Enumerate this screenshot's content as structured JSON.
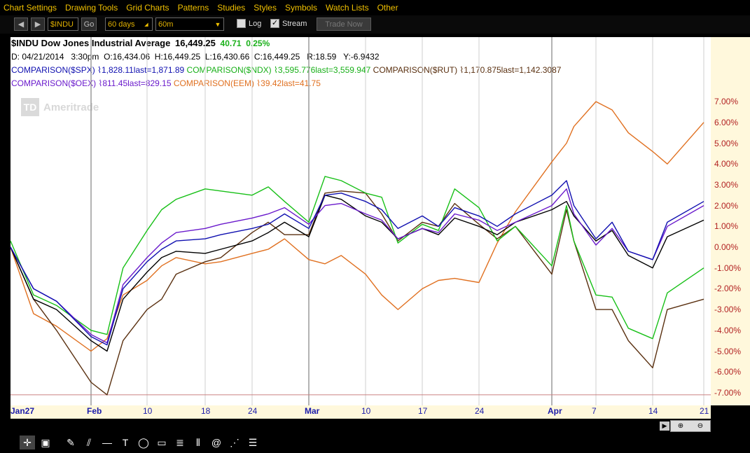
{
  "menu": [
    "Chart Settings",
    "Drawing Tools",
    "Grid Charts",
    "Patterns",
    "Studies",
    "Styles",
    "Symbols",
    "Watch Lists",
    "Other"
  ],
  "toolbar": {
    "symbol": "$INDU",
    "go_label": "Go",
    "period": "60 days",
    "interval": "60m",
    "log_label": "Log",
    "stream_label": "Stream",
    "trade_now_label": "Trade Now"
  },
  "legend": {
    "title": "$INDU Dow Jones Industrial Average",
    "price": "16,449.25",
    "change": "40.71",
    "change_pct": "0.25%",
    "info_line": "D: 04/21/2014   3:30pm  O:16,434.06  H:16,449.25  L:16,430.66  C:16,449.25   R:18.59   Y:-6.9432",
    "spx": "COMPARISON($SPX) ⌇1,828.11last=1,871.89",
    "ndx": "COMPARISON($NDX) ⌇3,595.776last=3,559.947",
    "rut": "COMPARISON($RUT) ⌇1,170.875last=1,142.3087",
    "oex": "COMPARISON($OEX) ⌇811.45last=829.15",
    "eem": "COMPARISON(EEM) ⌇39.42last=41.75"
  },
  "watermark": "Ameritrade",
  "colors": {
    "indu": "#000000",
    "spx": "#1010b0",
    "ndx": "#18c018",
    "rut": "#5a3010",
    "oex": "#6a1acc",
    "eem": "#e07020"
  },
  "chart_data": {
    "type": "line",
    "y_axis_unit": "%",
    "ylim": [
      -7.5,
      7.5
    ],
    "y_ticks": [
      "7.00%",
      "6.00%",
      "5.00%",
      "4.00%",
      "3.00%",
      "2.00%",
      "1.00%",
      "0.00%",
      "-1.00%",
      "-2.00%",
      "-3.00%",
      "-4.00%",
      "-5.00%",
      "-6.00%",
      "-7.00%"
    ],
    "x_ticks": [
      {
        "label": "Jan27",
        "month": true
      },
      {
        "label": "Feb",
        "month": true
      },
      {
        "label": "10",
        "month": false
      },
      {
        "label": "18",
        "month": false
      },
      {
        "label": "24",
        "month": false
      },
      {
        "label": "Mar",
        "month": true
      },
      {
        "label": "10",
        "month": false
      },
      {
        "label": "17",
        "month": false
      },
      {
        "label": "24",
        "month": false
      },
      {
        "label": "Apr",
        "month": true
      },
      {
        "label": "7",
        "month": false
      },
      {
        "label": "14",
        "month": false
      },
      {
        "label": "21",
        "month": false
      }
    ],
    "x_tick_dates": [
      "2014-01-27",
      "2014-02-03",
      "2014-02-10",
      "2014-02-18",
      "2014-02-24",
      "2014-03-03",
      "2014-03-10",
      "2014-03-17",
      "2014-03-24",
      "2014-04-01",
      "2014-04-07",
      "2014-04-14",
      "2014-04-21"
    ],
    "x_dates": [
      "2014-01-27",
      "2014-01-29",
      "2014-01-31",
      "2014-02-03",
      "2014-02-05",
      "2014-02-07",
      "2014-02-10",
      "2014-02-12",
      "2014-02-14",
      "2014-02-18",
      "2014-02-20",
      "2014-02-24",
      "2014-02-26",
      "2014-02-28",
      "2014-03-03",
      "2014-03-05",
      "2014-03-07",
      "2014-03-10",
      "2014-03-12",
      "2014-03-14",
      "2014-03-17",
      "2014-03-19",
      "2014-03-21",
      "2014-03-24",
      "2014-03-26",
      "2014-03-28",
      "2014-04-01",
      "2014-04-03",
      "2014-04-04",
      "2014-04-07",
      "2014-04-09",
      "2014-04-11",
      "2014-04-14",
      "2014-04-16",
      "2014-04-21"
    ],
    "series": [
      {
        "key": "indu",
        "values": [
          0.0,
          -2.5,
          -3.0,
          -4.5,
          -5.0,
          -2.5,
          -1.2,
          -0.5,
          -0.2,
          -0.3,
          -0.1,
          0.3,
          0.7,
          1.2,
          0.5,
          2.5,
          2.3,
          1.5,
          1.2,
          0.4,
          0.9,
          0.6,
          1.4,
          1.0,
          0.6,
          1.2,
          1.8,
          2.2,
          1.5,
          0.3,
          0.8,
          -0.4,
          -1.0,
          0.5,
          1.3
        ]
      },
      {
        "key": "spx",
        "values": [
          0.0,
          -2.0,
          -2.6,
          -4.3,
          -4.7,
          -2.0,
          -0.7,
          -0.1,
          0.3,
          0.4,
          0.6,
          0.9,
          1.1,
          1.6,
          0.9,
          2.5,
          2.6,
          2.2,
          1.8,
          0.9,
          1.5,
          1.0,
          1.9,
          1.5,
          1.0,
          1.6,
          2.5,
          3.2,
          2.0,
          0.4,
          1.2,
          -0.2,
          -0.6,
          1.2,
          2.2
        ]
      },
      {
        "key": "ndx",
        "values": [
          0.3,
          -2.3,
          -2.8,
          -4.0,
          -4.2,
          -1.0,
          0.8,
          1.8,
          2.3,
          2.8,
          2.7,
          2.5,
          2.9,
          2.2,
          1.2,
          3.4,
          3.2,
          2.6,
          2.4,
          0.2,
          1.1,
          0.8,
          2.8,
          1.9,
          0.3,
          1.0,
          -0.9,
          2.0,
          0.3,
          -2.3,
          -2.4,
          -3.9,
          -4.4,
          -2.2,
          -1.0
        ]
      },
      {
        "key": "rut",
        "values": [
          0.0,
          -2.5,
          -4.0,
          -6.5,
          -7.1,
          -4.5,
          -3.0,
          -2.5,
          -1.3,
          -0.7,
          -0.5,
          0.7,
          1.2,
          0.6,
          0.6,
          2.6,
          2.7,
          2.6,
          1.6,
          0.3,
          1.2,
          1.0,
          2.1,
          1.1,
          0.4,
          1.0,
          -1.3,
          1.8,
          0.3,
          -3.0,
          -3.0,
          -4.5,
          -5.8,
          -3.0,
          -2.5
        ]
      },
      {
        "key": "oex",
        "values": [
          0.0,
          -2.0,
          -2.6,
          -4.2,
          -4.6,
          -1.8,
          -0.5,
          0.2,
          0.7,
          0.9,
          1.1,
          1.4,
          1.6,
          1.9,
          1.1,
          2.0,
          2.1,
          1.6,
          1.3,
          0.4,
          0.9,
          0.7,
          1.6,
          1.3,
          0.8,
          1.2,
          2.0,
          2.8,
          1.6,
          0.1,
          0.9,
          -0.2,
          -0.6,
          1.0,
          2.0
        ]
      },
      {
        "key": "eem",
        "values": [
          0.0,
          -3.2,
          -3.8,
          -5.0,
          -4.4,
          -2.3,
          -1.6,
          -0.9,
          -0.5,
          -0.8,
          -0.7,
          -0.3,
          -0.1,
          0.4,
          -0.6,
          -0.8,
          -0.4,
          -1.3,
          -2.3,
          -3.0,
          -2.0,
          -1.6,
          -1.5,
          -1.7,
          0.2,
          1.7,
          4.1,
          5.0,
          5.8,
          7.0,
          6.6,
          5.5,
          4.6,
          4.0,
          6.0
        ]
      }
    ]
  }
}
